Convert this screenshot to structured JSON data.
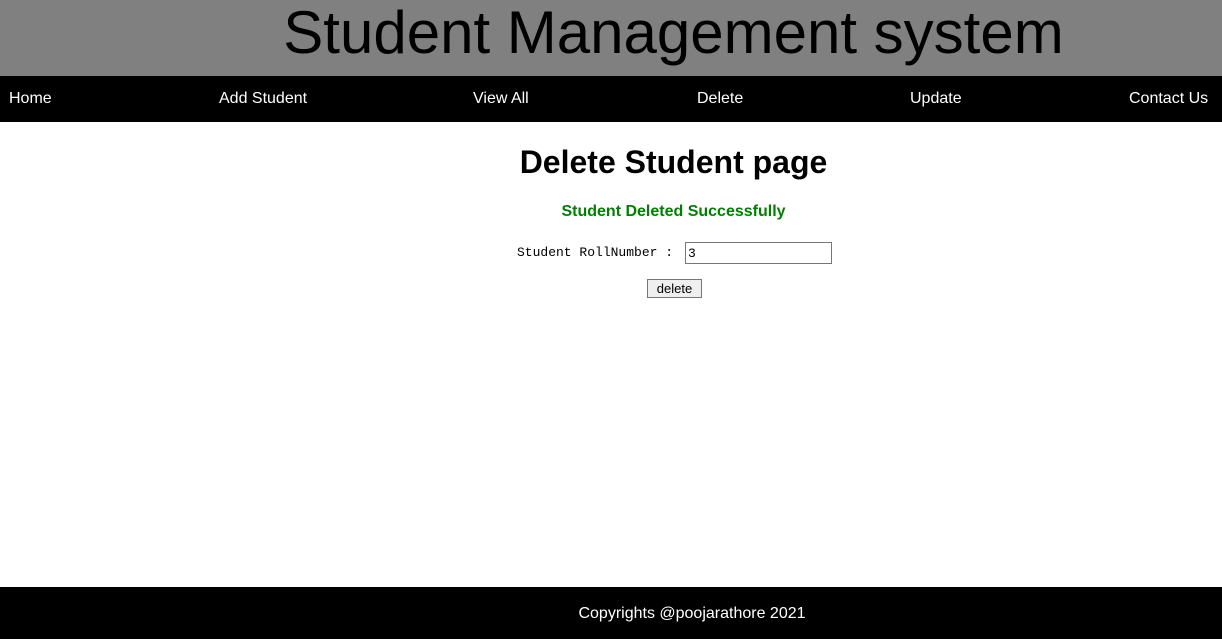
{
  "header": {
    "title": "Student Management system"
  },
  "nav": {
    "items": [
      {
        "label": "Home"
      },
      {
        "label": "Add Student"
      },
      {
        "label": "View All"
      },
      {
        "label": "Delete"
      },
      {
        "label": "Update"
      },
      {
        "label": "Contact Us"
      }
    ]
  },
  "main": {
    "page_title": "Delete Student page",
    "status_message": "Student Deleted Successfully",
    "form": {
      "roll_label": "Student RollNumber :",
      "roll_value": "3",
      "submit_label": "delete"
    }
  },
  "footer": {
    "text": "Copyrights @poojarathore 2021"
  },
  "colors": {
    "header_bg": "#808080",
    "nav_bg": "#000000",
    "success": "#008000",
    "footer_bg": "#000000"
  }
}
